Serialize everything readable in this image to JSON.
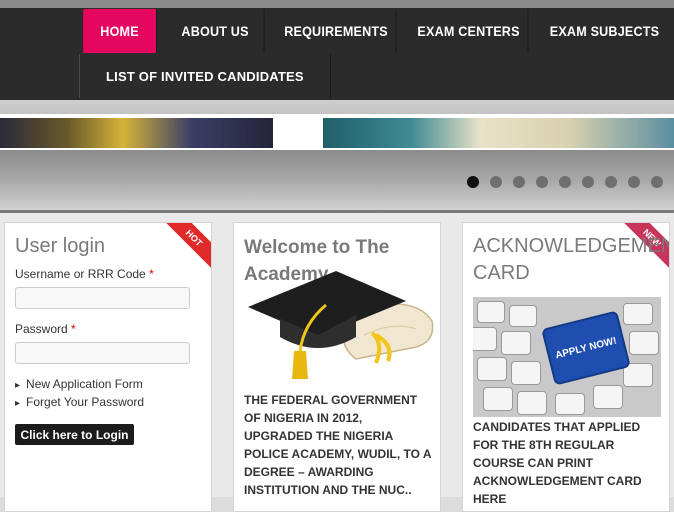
{
  "nav": {
    "items": [
      "HOME",
      "ABOUT US",
      "REQUIREMENTS",
      "EXAM CENTERS",
      "EXAM SUBJECTS"
    ],
    "row2": [
      "LIST OF INVITED CANDIDATES"
    ],
    "active_index": 0,
    "accent": "#e5065f"
  },
  "slider": {
    "dot_count": 9,
    "active_dot": 0
  },
  "login": {
    "title": "User login",
    "badge": "HOT",
    "username_label": "Username or RRR Code",
    "password_label": "Password",
    "required_mark": "*",
    "links": [
      "New Application Form",
      "Forget Your Password"
    ],
    "button": "Click here to Login"
  },
  "welcome": {
    "title": "Welcome to The Academy",
    "text": "THE FEDERAL GOVERNMENT OF NIGERIA IN 2012, UPGRADED THE NIGERIA POLICE ACADEMY, WUDIL, TO A DEGREE – AWARDING INSTITUTION AND THE NUC.."
  },
  "ack": {
    "title": "ACKNOWLEDGEMENT CARD",
    "badge": "NEW",
    "key_label": "APPLY NOW!",
    "text": "CANDIDATES THAT APPLIED FOR THE 8TH REGULAR COURSE CAN PRINT ACKNOWLEDGEMENT CARD HERE"
  }
}
